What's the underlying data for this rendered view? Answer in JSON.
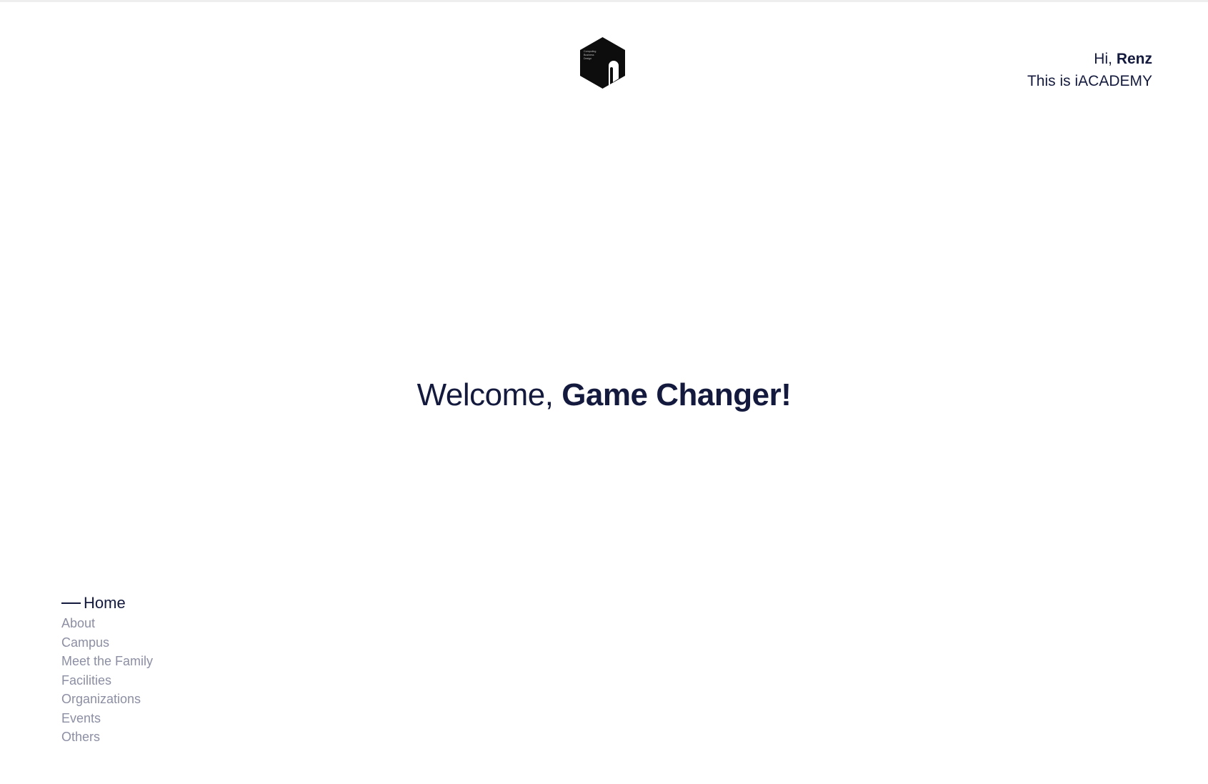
{
  "logo": {
    "icon": "iacademy-hexagon-logo",
    "lines": [
      "Computing",
      "Business",
      "Design"
    ]
  },
  "greeting": {
    "prefix": "Hi,",
    "name": "Renz",
    "subtitle": "This is iACADEMY"
  },
  "welcome": {
    "prefix": "Welcome,",
    "emphasis": "Game Changer!"
  },
  "nav": {
    "items": [
      {
        "label": "Home",
        "active": true
      },
      {
        "label": "About"
      },
      {
        "label": "Campus"
      },
      {
        "label": "Meet the Family"
      },
      {
        "label": "Facilities"
      },
      {
        "label": "Organizations"
      },
      {
        "label": "Events"
      },
      {
        "label": "Others"
      }
    ]
  },
  "colors": {
    "primary_text": "#141a3d",
    "muted_text": "#8c8fa3",
    "background": "#ffffff"
  }
}
